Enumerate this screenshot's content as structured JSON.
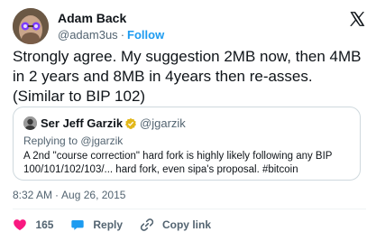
{
  "author": {
    "display_name": "Adam Back",
    "handle": "@adam3us",
    "separator": "·",
    "follow_label": "Follow"
  },
  "tweet": {
    "text": "Strongly agree.  My suggestion 2MB now, then 4MB in 2 years and 8MB in 4years then re-asses.  (Similar to BIP 102)"
  },
  "quoted": {
    "display_name": "Ser Jeff Garzik",
    "handle": "@jgarzik",
    "replying_prefix": "Replying to",
    "replying_to": "@jgarzik",
    "text": "A 2nd \"course correction\" hard fork is highly likely following any BIP 100/101/102/103/... hard fork, even sipa's proposal. #bitcoin"
  },
  "meta": {
    "time": "8:32 AM",
    "separator": "·",
    "date": "Aug 26, 2015"
  },
  "actions": {
    "like_count": "165",
    "reply_label": "Reply",
    "copy_label": "Copy link"
  },
  "colors": {
    "accent": "#1d9bf0",
    "like": "#f91880",
    "text": "#0f1419",
    "muted": "#536471",
    "border": "#cfd9de"
  },
  "icons": {
    "brand": "x-logo-icon",
    "like": "heart-icon",
    "reply": "speech-bubble-icon",
    "copy": "link-icon",
    "verified": "gold-verified-badge-icon"
  }
}
